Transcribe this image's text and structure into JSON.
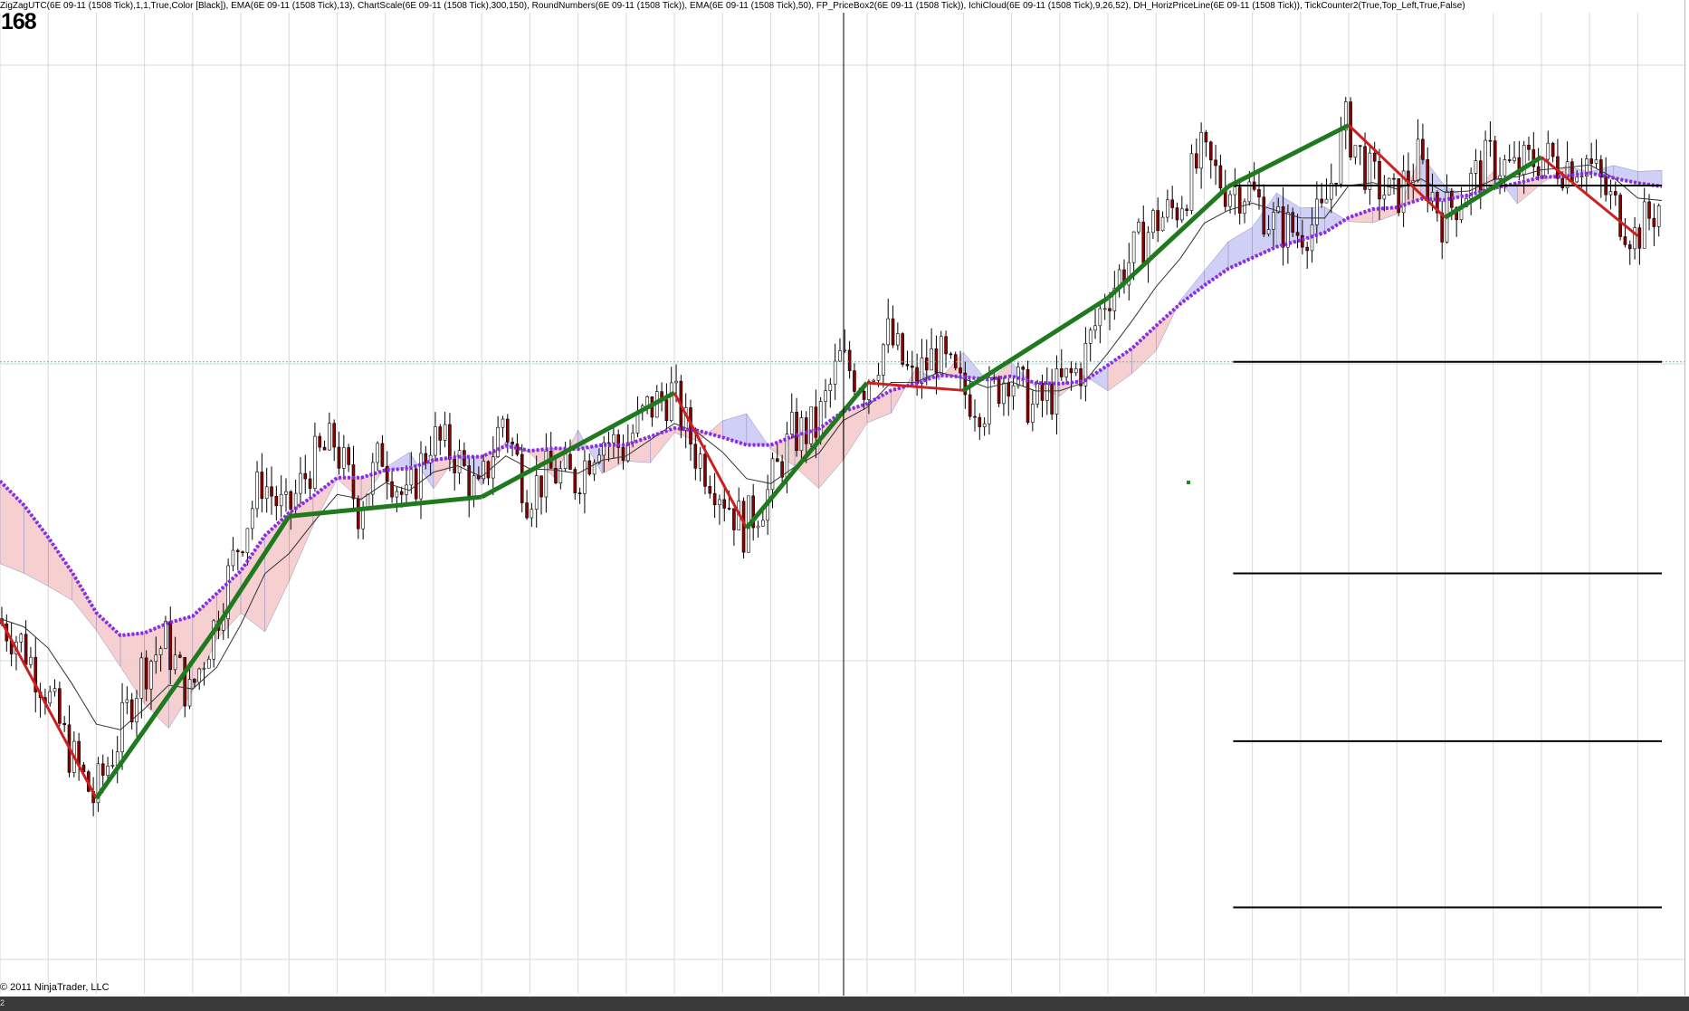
{
  "header": {
    "indicators_text": "ZigZagUTC(6E 09-11 (1508 Tick),1,1,True,Color [Black]), EMA(6E 09-11 (1508 Tick),13), ChartScale(6E 09-11 (1508 Tick),300,150), RoundNumbers(6E 09-11 (1508 Tick)), EMA(6E 09-11 (1508 Tick),50), FP_PriceBox2(6E 09-11 (1508 Tick)), IchiCloud(6E 09-11 (1508 Tick),9,26,52), DH_HorizPriceLine(6E 09-11 (1508 Tick)), TickCounter2(True,Top_Left,True,False)",
    "tick_counter": "168"
  },
  "footer": {
    "copyright": "© 2011 NinjaTrader, LLC",
    "scroll_label": "2"
  },
  "colors": {
    "background": "#ffffff",
    "grid": "#d9d9d9",
    "candles": "#000000",
    "bear_body": "#8b0000",
    "ema50": "#8a2be2",
    "cloud_bull": "#c8c8f5",
    "cloud_bear": "#f5c8c8",
    "up_trendline": "#1f7a1f",
    "down_trendline": "#cc2020",
    "horizontal_price_line": "#33cccc",
    "round_number_lines": "#000000"
  },
  "chart_data": {
    "type": "line",
    "instrument": "6E 09-11 (1508 Tick)",
    "x": [
      0,
      10,
      20,
      30,
      40,
      50,
      60,
      70,
      80,
      90,
      100,
      110,
      120,
      130,
      140,
      150,
      160,
      170,
      180,
      190,
      200,
      210,
      220,
      230,
      240,
      250,
      260,
      270,
      280,
      290,
      300,
      310,
      320,
      330,
      340,
      350,
      360,
      370,
      380,
      390,
      400,
      410,
      420,
      430,
      440,
      450,
      460,
      470,
      480,
      490,
      500,
      510,
      520,
      530,
      540,
      550,
      560,
      570,
      580,
      590,
      600,
      610,
      620,
      630,
      640,
      650,
      660,
      670,
      680,
      690
    ],
    "series": [
      {
        "values": [
          40.6,
          37.8,
          32.4,
          24.8,
          19.2,
          26.1,
          34.5,
          37.9,
          31.4,
          39.6,
          49.4,
          57.2,
          52.8,
          58.8,
          61.7,
          53.8,
          60.4,
          54.2,
          62.1,
          60.2,
          55.1,
          64.6,
          55.6,
          58.1,
          57.1,
          62.4,
          60.9,
          65.5,
          67.5,
          60.5,
          56.3,
          51.4,
          55.6,
          62.4,
          63.3,
          71.4,
          68.7,
          74.3,
          68.8,
          72.2,
          67.8,
          66.1,
          70.1,
          65.7,
          67.8,
          70.5,
          78.8,
          83.2,
          87.7,
          89.7,
          95.6,
          92.1,
          91.7,
          87.6,
          86.7,
          88.3,
          99.4,
          93.2,
          90.4,
          95.2,
          88.4,
          91.9,
          95.4,
          93.9,
          95.6,
          94.8,
          95.3,
          90.3,
          86.2,
          89.9
        ]
      },
      {
        "values": [
          57.0,
          54.1,
          50.3,
          46.1,
          41.3,
          38.6,
          38.9,
          40.1,
          40.9,
          43.6,
          46.3,
          50.5,
          53.2,
          55.2,
          57.4,
          57.4,
          58.3,
          58.5,
          59.5,
          59.9,
          59.9,
          61.2,
          60.6,
          60.9,
          60.8,
          61.3,
          61.3,
          62.3,
          63.3,
          63.0,
          62.2,
          61.3,
          61.3,
          62.4,
          63.2,
          65.3,
          66.2,
          67.8,
          68.6,
          69.6,
          69.4,
          69.1,
          69.5,
          68.7,
          68.6,
          68.9,
          70.8,
          72.8,
          75.5,
          78.1,
          80.3,
          82.3,
          83.6,
          84.9,
          85.7,
          86.6,
          88.4,
          89.4,
          89.6,
          90.6,
          90.5,
          91.1,
          91.9,
          92.5,
          93.2,
          93.3,
          93.7,
          93.1,
          92.5,
          92.1
        ]
      }
    ],
    "ylim": [
      0,
      110
    ],
    "xlim": [
      0,
      690
    ],
    "grid": true,
    "price_line_level": 71.2,
    "round_number_levels": [
      92.2,
      71.2,
      46.0,
      26.0,
      6.2
    ],
    "round_number_x_start": 512
  }
}
